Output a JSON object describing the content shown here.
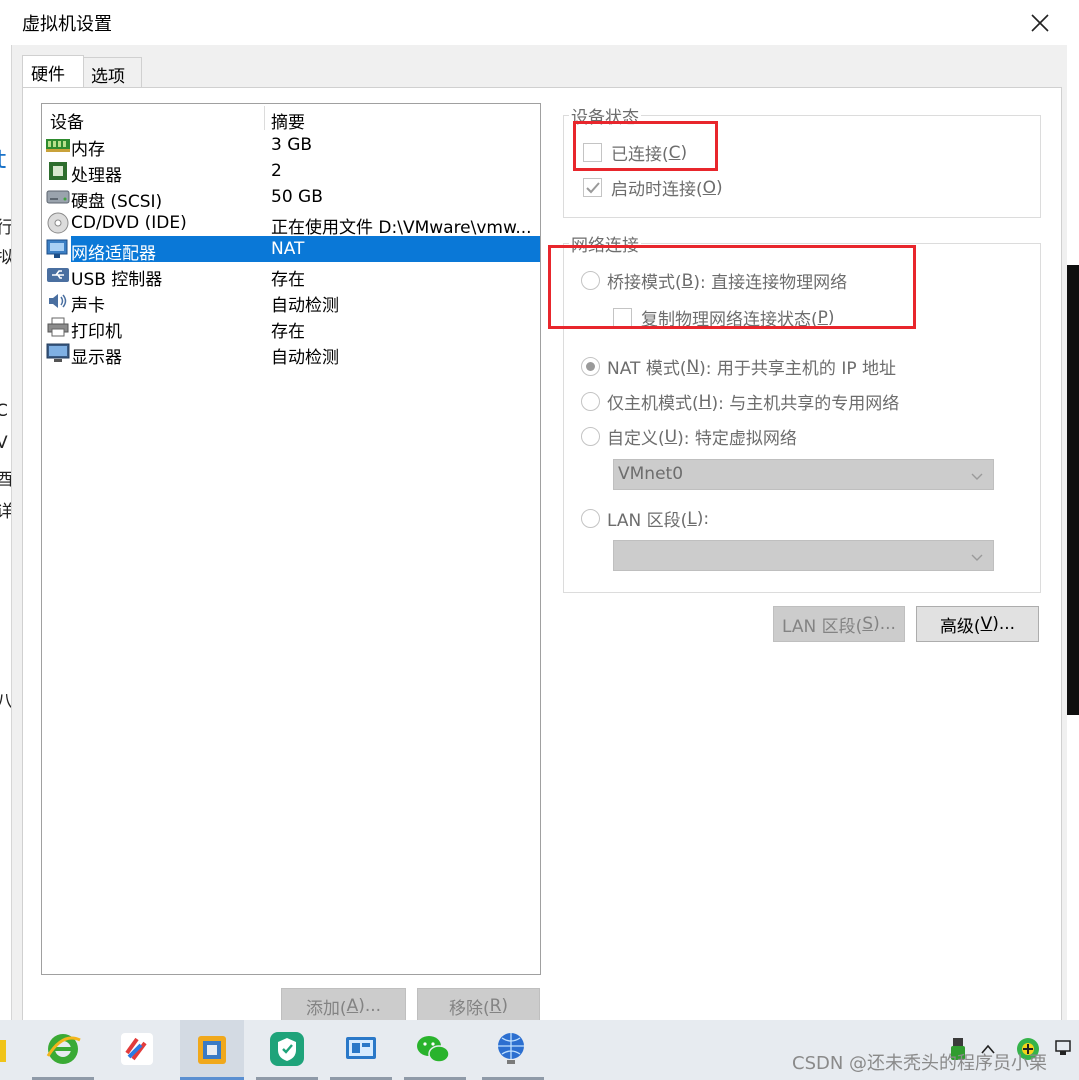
{
  "window": {
    "title": "虚拟机设置"
  },
  "tabs": [
    {
      "label": "硬件"
    },
    {
      "label": "选项"
    }
  ],
  "device_list": {
    "col_device": "设备",
    "col_summary": "摘要",
    "rows": [
      {
        "name": "内存",
        "summary": "3 GB",
        "icon": "memory-icon"
      },
      {
        "name": "处理器",
        "summary": "2",
        "icon": "processor-icon"
      },
      {
        "name": "硬盘 (SCSI)",
        "summary": "50 GB",
        "icon": "hard-disk-icon"
      },
      {
        "name": "CD/DVD (IDE)",
        "summary": "正在使用文件 D:\\VMware\\vmw...",
        "icon": "cd-dvd-icon"
      },
      {
        "name": "网络适配器",
        "summary": "NAT",
        "icon": "network-adapter-icon",
        "selected": true
      },
      {
        "name": "USB 控制器",
        "summary": "存在",
        "icon": "usb-icon"
      },
      {
        "name": "声卡",
        "summary": "自动检测",
        "icon": "sound-card-icon"
      },
      {
        "name": "打印机",
        "summary": "存在",
        "icon": "printer-icon"
      },
      {
        "name": "显示器",
        "summary": "自动检测",
        "icon": "display-icon"
      }
    ]
  },
  "buttons": {
    "add_prefix": "添加(",
    "add_key": "A",
    "add_suffix": ")...",
    "remove_prefix": "移除(",
    "remove_key": "R",
    "remove_suffix": ")",
    "lan_prefix": "LAN 区段(",
    "lan_key": "S",
    "lan_suffix": ")...",
    "advanced_prefix": "高级(",
    "advanced_key": "V",
    "advanced_suffix": ")..."
  },
  "device_status": {
    "label": "设备状态",
    "connected_prefix": "已连接(",
    "connected_key": "C",
    "connected_suffix": ")",
    "connected_checked": false,
    "connect_on_start_prefix": "启动时连接(",
    "connect_on_start_key": "O",
    "connect_on_start_suffix": ")",
    "connect_on_start_checked": true
  },
  "network": {
    "label": "网络连接",
    "bridged_prefix": "桥接模式(",
    "bridged_key": "B",
    "bridged_suffix": "): 直接连接物理网络",
    "replicate_prefix": "复制物理网络连接状态(",
    "replicate_key": "P",
    "replicate_suffix": ")",
    "nat_prefix": "NAT 模式(",
    "nat_key": "N",
    "nat_suffix": "): 用于共享主机的 IP 地址",
    "host_only_prefix": "仅主机模式(",
    "host_only_key": "H",
    "host_only_suffix": "): 与主机共享的专用网络",
    "custom_prefix": "自定义(",
    "custom_key": "U",
    "custom_suffix": "): 特定虚拟网络",
    "custom_select": "VMnet0",
    "lan_segment_prefix": "LAN 区段(",
    "lan_segment_key": "L",
    "lan_segment_suffix": "):",
    "lan_segment_select": "",
    "selected": "nat"
  },
  "background": {
    "fragments": [
      "t",
      "行",
      "拟",
      "C",
      "V",
      "酉",
      "详",
      "八"
    ]
  },
  "taskbar": {
    "apps": [
      "ie-browser-icon",
      "app-icon",
      "vmware-icon",
      "app-store-icon",
      "screen-app-icon",
      "wechat-icon",
      "network-globe-icon"
    ]
  },
  "watermark": "CSDN @还未秃头的程序员小栗",
  "colors": {
    "accent": "#0a78d7",
    "highlight_box": "#e8262c"
  }
}
